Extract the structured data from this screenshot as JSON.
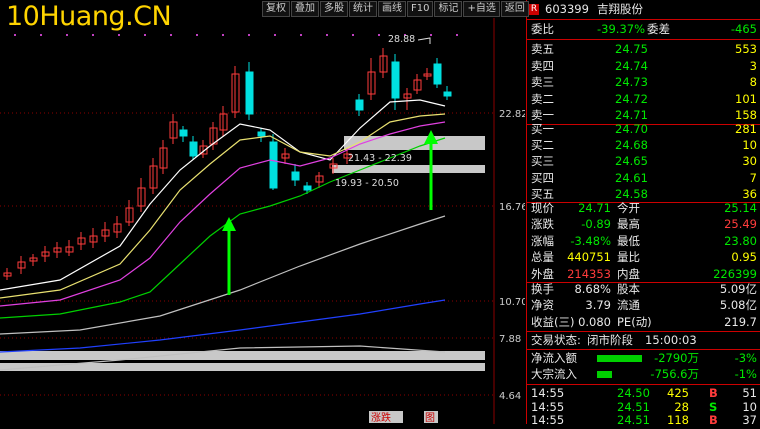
{
  "watermark": "10Huang.CN",
  "toolbar": [
    "复权",
    "叠加",
    "多股",
    "统计",
    "画线",
    "F10",
    "标记",
    "+自选",
    "返回"
  ],
  "price_axis": [
    "22.82",
    "16.76",
    "10.70",
    "7.88",
    "4.64"
  ],
  "annotations": {
    "high": "28.88",
    "gap1": "21.43 - 22.39",
    "gap2": "19.93 - 20.50"
  },
  "bottom_badges": {
    "zhangdie": "涨跌",
    "tu": "图"
  },
  "stock": {
    "code": "603399",
    "name": "吉翔股份"
  },
  "weibi": {
    "label": "委比",
    "value": "-39.37%",
    "label2": "委差",
    "value2": "-465"
  },
  "asks": [
    {
      "label": "卖五",
      "price": "24.75",
      "vol": "553"
    },
    {
      "label": "卖四",
      "price": "24.74",
      "vol": "3"
    },
    {
      "label": "卖三",
      "price": "24.73",
      "vol": "8"
    },
    {
      "label": "卖二",
      "price": "24.72",
      "vol": "101"
    },
    {
      "label": "卖一",
      "price": "24.71",
      "vol": "158"
    }
  ],
  "bids": [
    {
      "label": "买一",
      "price": "24.70",
      "vol": "281"
    },
    {
      "label": "买二",
      "price": "24.68",
      "vol": "10"
    },
    {
      "label": "买三",
      "price": "24.65",
      "vol": "30"
    },
    {
      "label": "买四",
      "price": "24.61",
      "vol": "7"
    },
    {
      "label": "买五",
      "price": "24.58",
      "vol": "36"
    }
  ],
  "quote": [
    {
      "l1": "现价",
      "v1": "24.71",
      "l2": "今开",
      "v2": "25.14"
    },
    {
      "l1": "涨跌",
      "v1": "-0.89",
      "l2": "最高",
      "v2": "25.49"
    },
    {
      "l1": "涨幅",
      "v1": "-3.48%",
      "l2": "最低",
      "v2": "23.80"
    },
    {
      "l1": "总量",
      "v1": "440751",
      "l2": "量比",
      "v2": "0.95"
    },
    {
      "l1": "外盘",
      "v1": "214353",
      "l2": "内盘",
      "v2": "226399"
    }
  ],
  "fund": [
    {
      "l1": "换手",
      "v1": "8.68%",
      "l2": "股本",
      "v2": "5.09亿"
    },
    {
      "l1": "净资",
      "v1": "3.79",
      "l2": "流通",
      "v2": "5.08亿"
    },
    {
      "l1": "收益(三)",
      "v1": "0.080",
      "l2": "PE(动)",
      "v2": "219.7"
    }
  ],
  "status": {
    "label": "交易状态:",
    "value": "闭市阶段",
    "time": "15:00:03"
  },
  "flows": [
    {
      "label": "净流入额",
      "value": "-2790万",
      "pct": "-3%",
      "fill": 0.75
    },
    {
      "label": "大宗流入",
      "value": "-756.6万",
      "pct": "-1%",
      "fill": 0.25
    }
  ],
  "ticks": [
    {
      "time": "14:55",
      "price": "24.50",
      "vol": "425",
      "side": "B",
      "n": "51"
    },
    {
      "time": "14:55",
      "price": "24.51",
      "vol": "28",
      "side": "S",
      "n": "10"
    },
    {
      "time": "14:55",
      "price": "24.51",
      "vol": "118",
      "side": "B",
      "n": "37"
    }
  ],
  "colors": {
    "up": "#ff3c3c",
    "down": "#00e0e0",
    "grid": "#8b0000",
    "ma5": "#ffffff",
    "ma10": "#e8e070",
    "ma20": "#e040e0",
    "ma30": "#00d000",
    "ma60": "#c0c0c0",
    "ma120": "#2040ff",
    "arrow": "#00ff00"
  }
}
